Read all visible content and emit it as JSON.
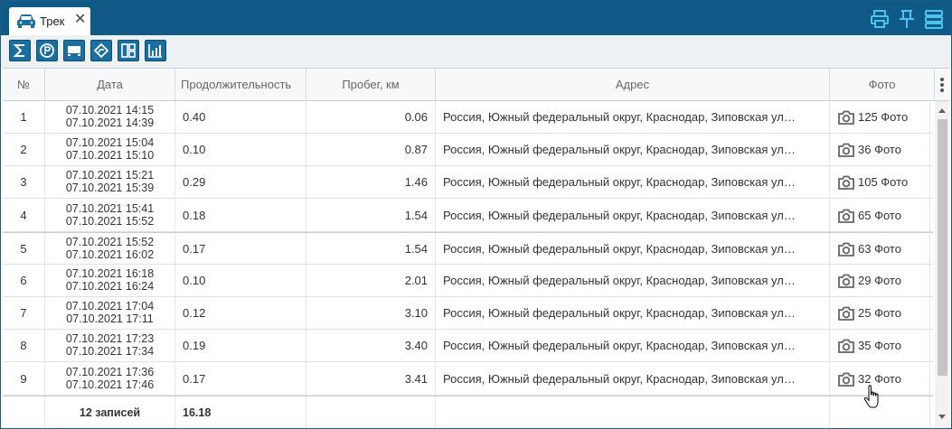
{
  "tab": {
    "title": "Трек",
    "close": "✕"
  },
  "toolbar": {
    "buttons": [
      "summary-icon",
      "parking-icon",
      "truck-icon",
      "route-icon",
      "layout-icon",
      "chart-icon"
    ]
  },
  "header_actions": [
    "print-icon",
    "pin-icon",
    "columns-icon"
  ],
  "columns": {
    "num": "№",
    "date": "Дата",
    "duration": "Продолжительность",
    "mileage": "Пробег, км",
    "address": "Адрес",
    "photo": "Фото"
  },
  "rows": [
    {
      "num": "1",
      "start": "07.10.2021 14:15",
      "end": "07.10.2021 14:39",
      "duration": "0.40",
      "km": "0.06",
      "address": "Россия, Южный федеральный округ, Краснодар, Зиповская улица",
      "photo": "125 Фото"
    },
    {
      "num": "2",
      "start": "07.10.2021 15:04",
      "end": "07.10.2021 15:10",
      "duration": "0.10",
      "km": "0.87",
      "address": "Россия, Южный федеральный округ, Краснодар, Зиповская улица",
      "photo": "36 Фото"
    },
    {
      "num": "3",
      "start": "07.10.2021 15:21",
      "end": "07.10.2021 15:39",
      "duration": "0.29",
      "km": "1.46",
      "address": "Россия, Южный федеральный округ, Краснодар, Зиповская улица",
      "photo": "105 Фото"
    },
    {
      "num": "4",
      "start": "07.10.2021 15:41",
      "end": "07.10.2021 15:52",
      "duration": "0.18",
      "km": "1.54",
      "address": "Россия, Южный федеральный округ, Краснодар, Зиповская улица",
      "photo": "65 Фото"
    },
    {
      "num": "5",
      "start": "07.10.2021 15:52",
      "end": "07.10.2021 16:02",
      "duration": "0.17",
      "km": "1.54",
      "address": "Россия, Южный федеральный округ, Краснодар, Зиповская улица",
      "photo": "63 Фото"
    },
    {
      "num": "6",
      "start": "07.10.2021 16:18",
      "end": "07.10.2021 16:24",
      "duration": "0.10",
      "km": "2.01",
      "address": "Россия, Южный федеральный округ, Краснодар, Зиповская улица",
      "photo": "29 Фото"
    },
    {
      "num": "7",
      "start": "07.10.2021 17:04",
      "end": "07.10.2021 17:11",
      "duration": "0.12",
      "km": "3.10",
      "address": "Россия, Южный федеральный округ, Краснодар, Зиповская улица",
      "photo": "25 Фото"
    },
    {
      "num": "8",
      "start": "07.10.2021 17:23",
      "end": "07.10.2021 17:34",
      "duration": "0.19",
      "km": "3.40",
      "address": "Россия, Южный федеральный округ, Краснодар, Зиповская улица",
      "photo": "35 Фото"
    },
    {
      "num": "9",
      "start": "07.10.2021 17:36",
      "end": "07.10.2021 17:46",
      "duration": "0.17",
      "km": "3.41",
      "address": "Россия, Южный федеральный округ, Краснодар, Зиповская улица",
      "photo": "32 Фото"
    }
  ],
  "footer": {
    "count": "12 записей",
    "total_duration": "16.18"
  },
  "colors": {
    "header_bar": "#0f5a86",
    "button": "#1b6ea0",
    "toolbar_bg": "#eef1f4"
  }
}
